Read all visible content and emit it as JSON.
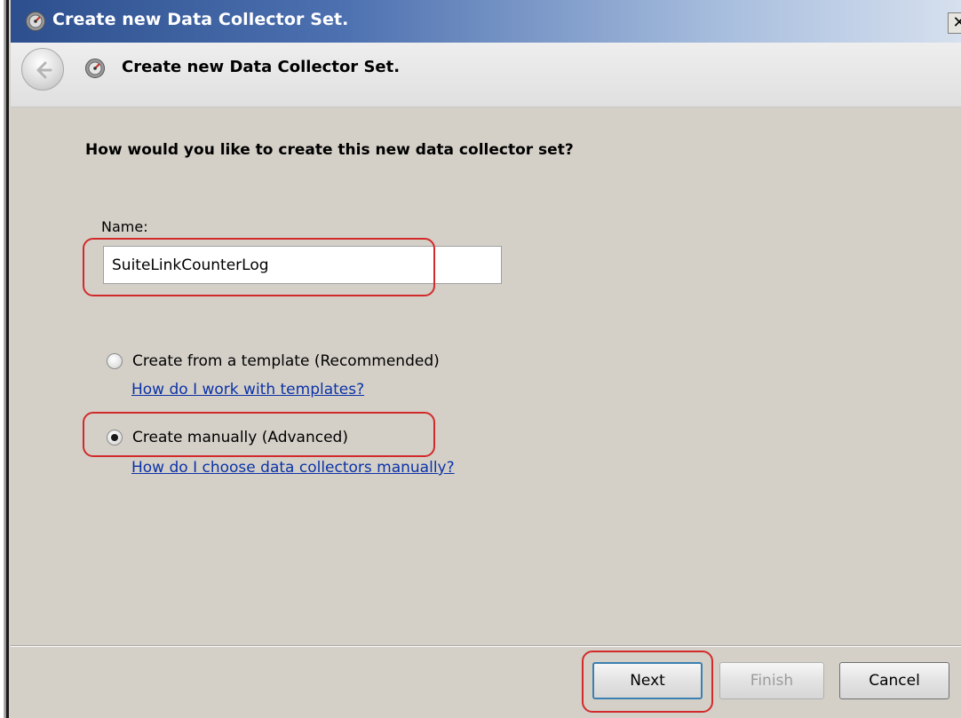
{
  "window": {
    "title": "Create new Data Collector Set.",
    "close_label": "✕"
  },
  "header": {
    "title": "Create new Data Collector Set."
  },
  "main": {
    "question": "How would you like to create this new data collector set?",
    "name_label": "Name:",
    "name_value": "SuiteLinkCounterLog",
    "options": [
      {
        "label": "Create from a template (Recommended)",
        "selected": false,
        "help_link": "How do I work with templates?"
      },
      {
        "label": "Create manually (Advanced)",
        "selected": true,
        "help_link": "How do I choose data collectors manually?"
      }
    ]
  },
  "footer": {
    "next_label": "Next",
    "finish_label": "Finish",
    "cancel_label": "Cancel",
    "finish_enabled": false
  },
  "colors": {
    "highlight": "#d22a2a",
    "link": "#0b32a8",
    "titlebar_start": "#2d4f8e"
  },
  "icons": [
    "perfmon-icon",
    "back-arrow-icon",
    "close-icon"
  ]
}
